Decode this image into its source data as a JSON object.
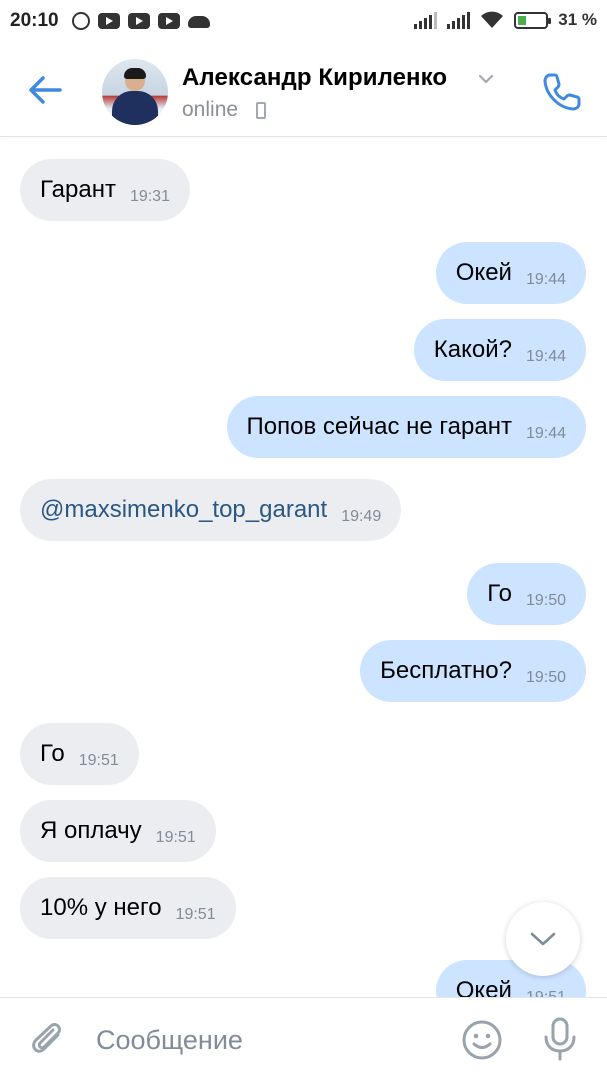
{
  "status_bar": {
    "time": "20:10",
    "battery_percent": "31 %",
    "battery_level": 0.31,
    "icons": [
      "chat-bubble-icon",
      "youtube-icon",
      "youtube-icon",
      "youtube-icon",
      "cloud-icon",
      "signal-icon",
      "signal-icon",
      "wifi-icon",
      "battery-charging-icon"
    ]
  },
  "header": {
    "name": "Александр Кириленко",
    "status": "online",
    "icons": [
      "back-arrow-icon",
      "chevron-down-icon",
      "mobile-phone-icon",
      "phone-call-icon"
    ]
  },
  "messages": [
    {
      "dir": "in",
      "text": "Гарант",
      "time": "19:31"
    },
    {
      "dir": "out",
      "text": "Окей",
      "time": "19:44"
    },
    {
      "dir": "out",
      "text": "Какой?",
      "time": "19:44"
    },
    {
      "dir": "out",
      "text": "Попов сейчас не гарант",
      "time": "19:44"
    },
    {
      "dir": "in",
      "text": "@maxsimenko_top_garant",
      "time": "19:49",
      "link": true
    },
    {
      "dir": "out",
      "text": "Го",
      "time": "19:50"
    },
    {
      "dir": "out",
      "text": "Бесплатно?",
      "time": "19:50"
    },
    {
      "dir": "in",
      "text": "Го",
      "time": "19:51"
    },
    {
      "dir": "in",
      "text": "Я оплачу",
      "time": "19:51"
    },
    {
      "dir": "in",
      "text": "10% у него",
      "time": "19:51"
    },
    {
      "dir": "out",
      "text": "Окей",
      "time": "19:51"
    }
  ],
  "composer": {
    "placeholder": "Сообщение",
    "icons": [
      "paperclip-icon",
      "emoji-icon",
      "microphone-icon"
    ]
  },
  "colors": {
    "accent": "#3f8ae0",
    "incoming_bubble": "#ebedf0",
    "outgoing_bubble": "#cce4ff",
    "link": "#2a5885",
    "muted": "#818c99"
  }
}
